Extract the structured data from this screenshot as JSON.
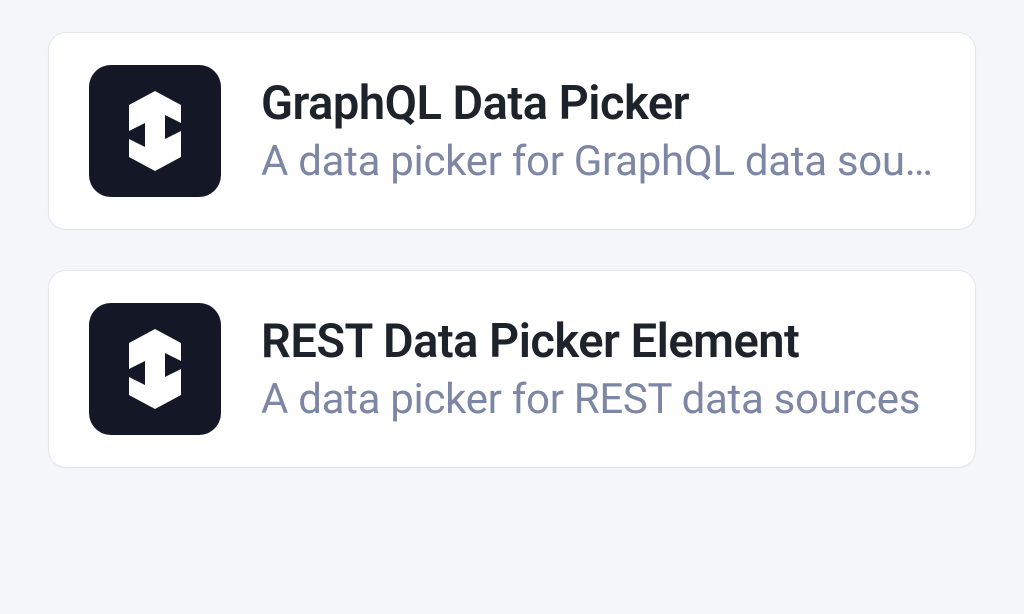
{
  "cards": [
    {
      "title": "GraphQL Data Picker",
      "description": "A data picker for GraphQL data sources"
    },
    {
      "title": "REST Data Picker Element",
      "description": "A data picker for REST data sources"
    }
  ]
}
